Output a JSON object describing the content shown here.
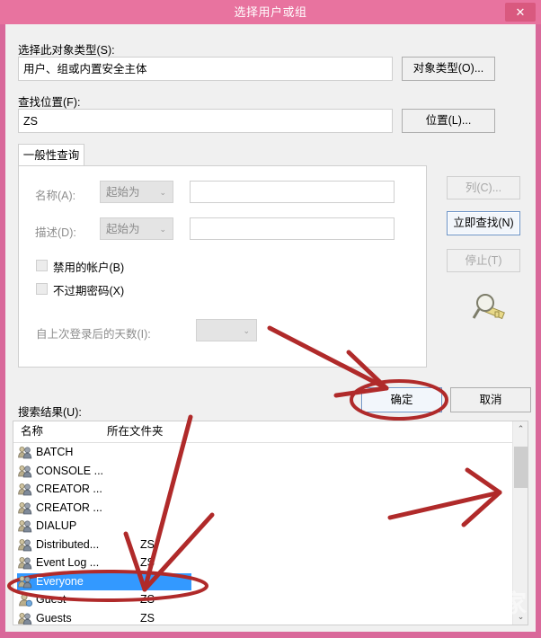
{
  "window": {
    "title": "选择用户或组",
    "close_label": "✕"
  },
  "form": {
    "object_type_label": "选择此对象类型(S):",
    "object_type_value": "用户、组或内置安全主体",
    "object_type_button": "对象类型(O)...",
    "location_label": "查找位置(F):",
    "location_value": "ZS",
    "location_button": "位置(L)..."
  },
  "tabs": [
    {
      "label": "一般性查询"
    }
  ],
  "query": {
    "name_label": "名称(A):",
    "name_condition": "起始为",
    "name_value": "",
    "desc_label": "描述(D):",
    "desc_condition": "起始为",
    "desc_value": "",
    "disabled_accounts_label": "禁用的帐户(B)",
    "non_expiring_password_label": "不过期密码(X)",
    "days_since_logon_label": "自上次登录后的天数(I):",
    "days_since_logon_value": "",
    "dropdown_arrow": "⌄"
  },
  "side_buttons": {
    "columns": "列(C)...",
    "find_now": "立即查找(N)",
    "stop": "停止(T)"
  },
  "actions": {
    "ok": "确定",
    "cancel": "取消"
  },
  "results": {
    "label": "搜索结果(U):",
    "columns": [
      "名称",
      "所在文件夹"
    ],
    "rows": [
      {
        "name": "BATCH",
        "folder": "",
        "icon": "group-icon",
        "selected": false
      },
      {
        "name": "CONSOLE ...",
        "folder": "",
        "icon": "group-icon",
        "selected": false
      },
      {
        "name": "CREATOR ...",
        "folder": "",
        "icon": "group-icon",
        "selected": false
      },
      {
        "name": "CREATOR ...",
        "folder": "",
        "icon": "group-icon",
        "selected": false
      },
      {
        "name": "DIALUP",
        "folder": "",
        "icon": "group-icon",
        "selected": false
      },
      {
        "name": "Distributed...",
        "folder": "ZS",
        "icon": "group-icon",
        "selected": false
      },
      {
        "name": "Event Log ...",
        "folder": "ZS",
        "icon": "group-icon",
        "selected": false
      },
      {
        "name": "Everyone",
        "folder": "",
        "icon": "group-icon",
        "selected": true
      },
      {
        "name": "Guest",
        "folder": "ZS",
        "icon": "user-icon",
        "selected": false
      },
      {
        "name": "Guests",
        "folder": "ZS",
        "icon": "group-icon",
        "selected": false
      }
    ],
    "scroll_up_arrow": "⌃",
    "scroll_down_arrow": "⌄"
  },
  "watermark": {
    "text": "系统之家"
  },
  "colors": {
    "titlebar": "#e8739f",
    "frame": "#d9689a",
    "dialog_bg": "#f0f0f0",
    "selection": "#3399ff",
    "annotation": "#b02a2a"
  }
}
